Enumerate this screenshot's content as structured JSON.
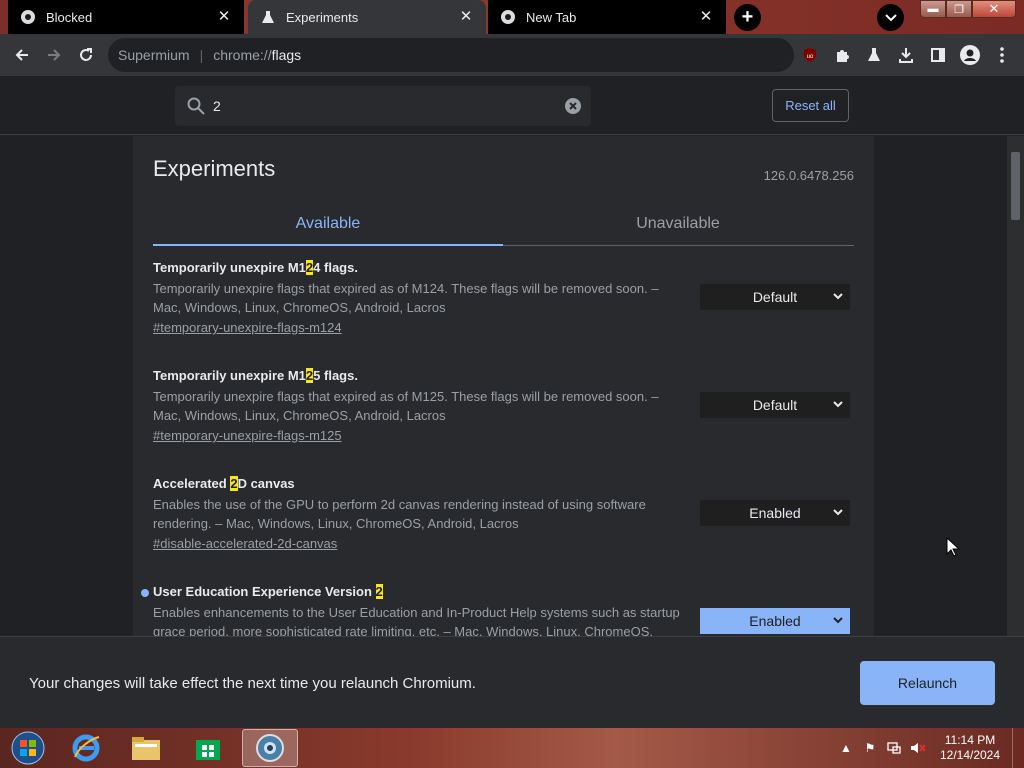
{
  "tabs": [
    {
      "title": "Blocked",
      "icon": "chrome-icon",
      "active": false
    },
    {
      "title": "Experiments",
      "icon": "flask-icon",
      "active": true
    },
    {
      "title": "New Tab",
      "icon": "chrome-icon",
      "active": false
    }
  ],
  "omnibox": {
    "site": "Supermium",
    "scheme": "chrome://",
    "path": "flags"
  },
  "search": {
    "value": "2"
  },
  "reset_all_label": "Reset all",
  "page": {
    "title": "Experiments",
    "version": "126.0.6478.256",
    "tab_available": "Available",
    "tab_unavailable": "Unavailable"
  },
  "flags": [
    {
      "name_pre": "Temporarily unexpire M1",
      "name_hl": "2",
      "name_post": "4 flags.",
      "desc": "Temporarily unexpire flags that expired as of M124. These flags will be removed soon. – Mac, Windows, Linux, ChromeOS, Android, Lacros",
      "link": "#temporary-unexpire-flags-m124",
      "value": "Default"
    },
    {
      "name_pre": "Temporarily unexpire M1",
      "name_hl": "2",
      "name_post": "5 flags.",
      "desc": "Temporarily unexpire flags that expired as of M125. These flags will be removed soon. – Mac, Windows, Linux, ChromeOS, Android, Lacros",
      "link": "#temporary-unexpire-flags-m125",
      "value": "Default"
    },
    {
      "name_pre": "Accelerated ",
      "name_hl": "2",
      "name_post": "D canvas",
      "desc": "Enables the use of the GPU to perform 2d canvas rendering instead of using software rendering. – Mac, Windows, Linux, ChromeOS, Android, Lacros",
      "link": "#disable-accelerated-2d-canvas",
      "value": "Enabled"
    },
    {
      "name_pre": "User Education Experience Version ",
      "name_hl": "2",
      "name_post": "",
      "desc": "Enables enhancements to the User Education and In-Product Help systems such as startup grace period, more sophisticated rate limiting, etc. – Mac, Windows, Linux, ChromeOS, Lacros",
      "link": "",
      "value": "Enabled"
    }
  ],
  "relaunch": {
    "message": "Your changes will take effect the next time you relaunch Chromium.",
    "button": "Relaunch"
  },
  "taskbar": {
    "apps": [
      "start-orb-icon",
      "internet-explorer-icon",
      "file-explorer-icon",
      "store-icon",
      "supermium-icon"
    ],
    "time": "11:14 PM",
    "date": "12/14/2024"
  },
  "colors": {
    "accent": "#8ab4f8",
    "highlight": "#f8e71c",
    "background": "#202124"
  }
}
